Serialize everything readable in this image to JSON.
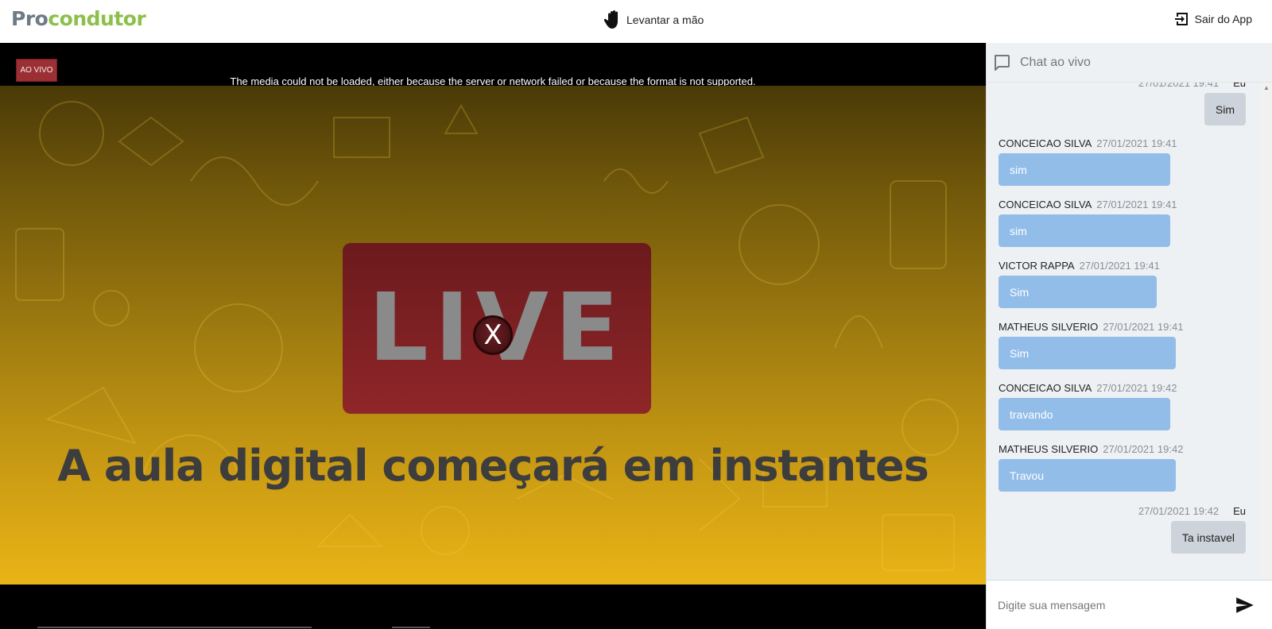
{
  "header": {
    "logo_part1": "Pro",
    "logo_part2": "condutor",
    "raise_hand_label": "Levantar a mão",
    "exit_label": "Sair do App"
  },
  "video": {
    "live_badge": "AO VIVO",
    "error_message": "The media could not be loaded, either because the server or network failed or because the format is not supported.",
    "poster_live_text": "LIVE",
    "close_glyph": "X",
    "poster_headline": "A aula digital começará em instantes"
  },
  "chat": {
    "title": "Chat ao vivo",
    "partial_top": {
      "time": "27/01/2021 19:41",
      "author": "Eu"
    },
    "messages": [
      {
        "mine": true,
        "author": "Eu",
        "time": "27/01/2021 19:41",
        "text": "Sim"
      },
      {
        "mine": false,
        "author": "CONCEICAO SILVA",
        "time": "27/01/2021 19:41",
        "text": "sim"
      },
      {
        "mine": false,
        "author": "CONCEICAO SILVA",
        "time": "27/01/2021 19:41",
        "text": "sim"
      },
      {
        "mine": false,
        "author": "VICTOR RAPPA",
        "time": "27/01/2021 19:41",
        "text": "Sim"
      },
      {
        "mine": false,
        "author": "MATHEUS SILVERIO",
        "time": "27/01/2021 19:41",
        "text": "Sim"
      },
      {
        "mine": false,
        "author": "CONCEICAO SILVA",
        "time": "27/01/2021 19:42",
        "text": "travando"
      },
      {
        "mine": false,
        "author": "MATHEUS SILVERIO",
        "time": "27/01/2021 19:42",
        "text": "Travou"
      },
      {
        "mine": true,
        "author": "Eu",
        "time": "27/01/2021 19:42",
        "text": "Ta instavel"
      }
    ],
    "input_placeholder": "Digite sua mensagem"
  },
  "colors": {
    "logo_gray": "#6e7b85",
    "logo_green": "#8cc04a",
    "bubble_other": "#92bde9",
    "bubble_mine": "#ccd3da",
    "live_red": "#8d2427"
  }
}
